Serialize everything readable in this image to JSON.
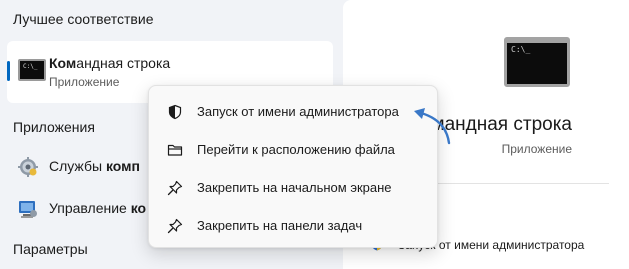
{
  "left": {
    "best_match_title": "Лучшее соответствие",
    "best_match": {
      "title_bold": "Ком",
      "title_rest": "андная строка",
      "subtitle": "Приложение"
    },
    "apps_title": "Приложения",
    "apps": [
      {
        "icon": "services-gear-icon",
        "label_start": "Службы ",
        "label_bold": "комп"
      },
      {
        "icon": "computer-management-icon",
        "label_start": "Управление ",
        "label_bold": "ко"
      }
    ],
    "settings_title": "Параметры"
  },
  "preview": {
    "title": "Командная строка",
    "subtitle": "Приложение",
    "action_open_partial": "ть",
    "action_run_admin": "Запуск от имени администратора"
  },
  "context_menu": {
    "items": [
      {
        "icon": "shield-icon",
        "label": "Запуск от имени администратора"
      },
      {
        "icon": "folder-icon",
        "label": "Перейти к расположению файла"
      },
      {
        "icon": "pin-icon",
        "label": "Закрепить на начальном экране"
      },
      {
        "icon": "pin-icon",
        "label": "Закрепить на панели задач"
      }
    ]
  },
  "colors": {
    "accent": "#0067c0",
    "arrow": "#3a78c7",
    "background": "#f1f3f7"
  }
}
